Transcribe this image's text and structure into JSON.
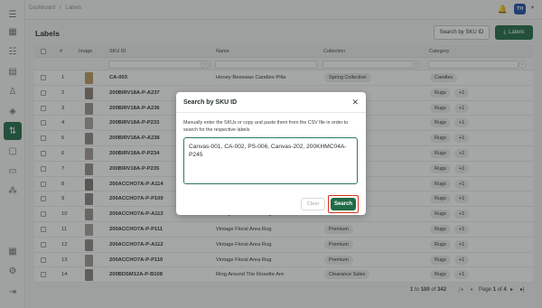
{
  "breadcrumb": [
    "Dashboard",
    "/",
    "Labels"
  ],
  "user": {
    "initials": "TH"
  },
  "page": {
    "title": "Labels",
    "search_sku_label": "Search by SKU ID",
    "labels_button": "Labels"
  },
  "table": {
    "columns": [
      "#",
      "Image",
      "SKU ID",
      "Name",
      "Collection",
      "Category"
    ],
    "rows": [
      {
        "n": "1",
        "sku": "CA-003",
        "name": "Honey Beeswax Candles Pilla",
        "collection": "Spring Collection",
        "category": "Candles",
        "extra": ""
      },
      {
        "n": "2",
        "sku": "200BIRV18A-P-A237",
        "name": "",
        "collection": "",
        "category": "Rugs",
        "extra": "+1"
      },
      {
        "n": "3",
        "sku": "200BIRV18A-P-A236",
        "name": "",
        "collection": "",
        "category": "Rugs",
        "extra": "+1"
      },
      {
        "n": "4",
        "sku": "200BIRV18A-P-P233",
        "name": "",
        "collection": "",
        "category": "Rugs",
        "extra": "+1"
      },
      {
        "n": "5",
        "sku": "200BIRV18A-P-A238",
        "name": "",
        "collection": "",
        "category": "Rugs",
        "extra": "+1"
      },
      {
        "n": "6",
        "sku": "200BIRV18A-P-P234",
        "name": "",
        "collection": "",
        "category": "Rugs",
        "extra": "+1"
      },
      {
        "n": "7",
        "sku": "200BIRV18A-P-P235",
        "name": "",
        "collection": "",
        "category": "Rugs",
        "extra": "+1"
      },
      {
        "n": "8",
        "sku": "200ACCHO7A-P-A114",
        "name": "",
        "collection": "",
        "category": "Rugs",
        "extra": "+1"
      },
      {
        "n": "9",
        "sku": "200ACCHO7A-P-P109",
        "name": "",
        "collection": "",
        "category": "Rugs",
        "extra": "+1"
      },
      {
        "n": "10",
        "sku": "200ACCHO7A-P-A113",
        "name": "Vintage Floral Area Rug",
        "collection": "",
        "category": "Rugs",
        "extra": "+1"
      },
      {
        "n": "11",
        "sku": "200ACCHO7A-P-P111",
        "name": "Vintage Floral Area Rug",
        "collection": "Premium",
        "category": "Rugs",
        "extra": "+1"
      },
      {
        "n": "12",
        "sku": "200ACCHO7A-P-A112",
        "name": "Vintage Floral Area Rug",
        "collection": "Premium",
        "category": "Rugs",
        "extra": "+1"
      },
      {
        "n": "13",
        "sku": "200ACCHO7A-P-P110",
        "name": "Vintage Floral Area Rug",
        "collection": "Premium",
        "category": "Rugs",
        "extra": "+1"
      },
      {
        "n": "14",
        "sku": "200BDSM12A-P-B108",
        "name": "Ring Around The Rosette Are",
        "collection": "Clearance Sales",
        "category": "Rugs",
        "extra": "+1"
      }
    ]
  },
  "pagination": {
    "from": "1",
    "to_prefix": "to",
    "to": "100",
    "of": "of",
    "total": "342",
    "page_label": "Page",
    "page": "1",
    "of_label": "of",
    "pages": "4"
  },
  "modal": {
    "title": "Search by SKU ID",
    "description": "Manually enter the SKUs or copy and paste them from the CSV file in order to search for the respective labels",
    "input_value": "Canvas-001, CA-002, PS-006, Canvas-202, 200KHMC04A-P245",
    "clear_label": "Clear",
    "search_label": "Search"
  },
  "colors": {
    "brand": "#1f6b47",
    "highlight": "#d9331f"
  }
}
